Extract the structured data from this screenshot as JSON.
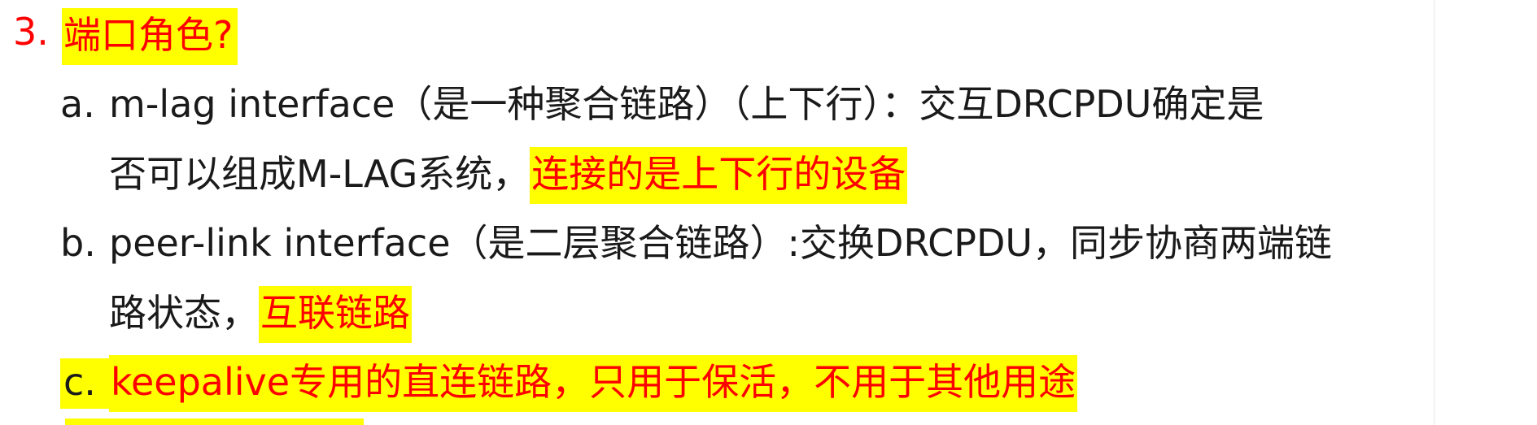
{
  "heading": {
    "number": "3.",
    "title": "端口角色?"
  },
  "items": [
    {
      "marker": "a.",
      "line1": "m-lag interface（是一种聚合链路）（上下行）：交互DRCPDU确定是",
      "line2_plain": "否可以组成M-LAG系统，",
      "line2_highlight": "连接的是上下行的设备"
    },
    {
      "marker": "b.",
      "line1": "peer-link interface（是二层聚合链路）:交换DRCPDU，同步协商两端链",
      "line2_plain": "路状态，",
      "line2_highlight": "互联链路"
    },
    {
      "marker": "c.",
      "line1_highlight": "keepalive专用的直连链路，只用于保活，不用于其他用途"
    }
  ],
  "colors": {
    "highlight": "#ffff00",
    "emphasis_text": "#ff0000",
    "body_text": "#1a1a1a"
  }
}
